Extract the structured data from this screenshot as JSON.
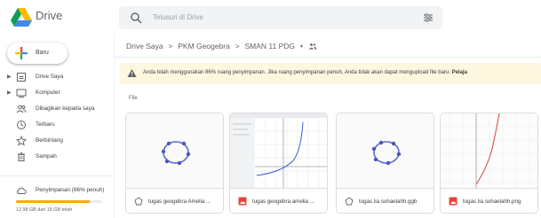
{
  "app": {
    "title": "Drive",
    "logo": "google-drive-logo"
  },
  "search": {
    "placeholder": "Telusuri di Drive",
    "icon": "search-icon",
    "options_icon": "search-options-icon"
  },
  "sidebar": {
    "new_label": "Baru",
    "items": [
      {
        "label": "Drive Saya",
        "icon": "drive-icon",
        "expandable": true
      },
      {
        "label": "Komputer",
        "icon": "computer-icon",
        "expandable": true
      },
      {
        "label": "Dibagikan kepada saya",
        "icon": "shared-icon",
        "expandable": false
      },
      {
        "label": "Terbaru",
        "icon": "clock-icon",
        "expandable": false
      },
      {
        "label": "Berbintang",
        "icon": "star-icon",
        "expandable": false
      },
      {
        "label": "Sampah",
        "icon": "trash-icon",
        "expandable": false
      },
      {
        "label": "Penyimpanan (86% penuh)",
        "icon": "cloud-icon",
        "expandable": false
      }
    ],
    "storage": {
      "percent": 86,
      "text": "12,98 GB dari 15 GB telah",
      "bar_color": "#f9ab00"
    }
  },
  "breadcrumb": [
    "Drive Saya",
    "PKM Geogebra",
    "SMAN 11 PDG"
  ],
  "warning": {
    "text": "Anda telah menggunakan 86% ruang penyimpanan. Jika ruang penyimpanan penuh, Anda tidak akan dapat mengupload file baru.",
    "bold_text": "Pelaja"
  },
  "files_label": "File",
  "files": [
    {
      "name": "tugas geogebra Amelia ...",
      "type": "geogebra",
      "icon": "geogebra-icon"
    },
    {
      "name": "tugas geogebra amelia ...",
      "type": "image",
      "icon": "image-icon"
    },
    {
      "name": "tugas lia suhaelahh.ggb",
      "type": "geogebra",
      "icon": "geogebra-icon"
    },
    {
      "name": "tugas lia suhaelahh.png",
      "type": "image",
      "icon": "image-icon"
    }
  ],
  "colors": {
    "accent": "#1a73e8",
    "image_icon": "#ea4335",
    "warning_bg": "#fef7e0",
    "warning_icon": "#5f6368"
  }
}
